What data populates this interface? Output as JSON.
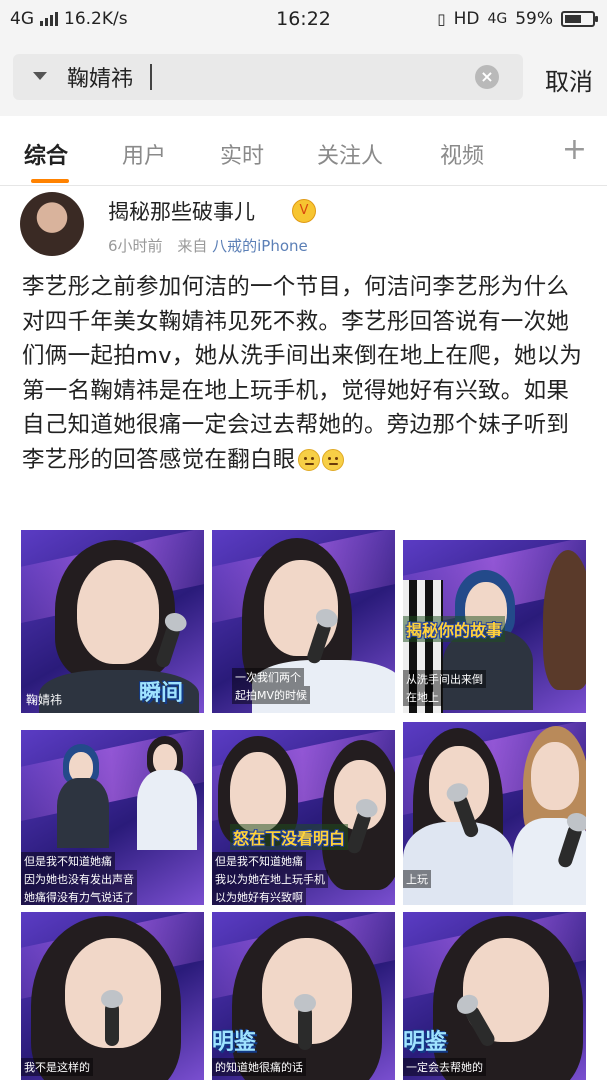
{
  "status_bar": {
    "network": "4G",
    "speed": "16.2K/s",
    "time": "16:22",
    "right_indicators": "HD",
    "network_right": "4G",
    "battery": "59%"
  },
  "search": {
    "query": "鞠婧祎",
    "cancel_label": "取消"
  },
  "tabs": [
    {
      "label": "综合",
      "active": true
    },
    {
      "label": "用户"
    },
    {
      "label": "实时"
    },
    {
      "label": "关注人"
    },
    {
      "label": "视频"
    }
  ],
  "tabs_plus": "+",
  "post": {
    "username": "揭秘那些破事儿",
    "time_ago": "6小时前",
    "from_label": "来自",
    "source": "八戒的iPhone",
    "text": "李艺彤之前参加何洁的一个节目，何洁问李艺彤为什么对四千年美女鞠婧祎见死不救。李艺彤回答说有一次她们俩一起拍mv，她从洗手间出来倒在地上在爬，她以为第一名鞠婧祎是在地上玩手机，觉得她好有兴致。如果自己知道她很痛一定会过去帮她的。旁边那个妹子听到李艺彤的回答感觉在翻白眼"
  },
  "images": {
    "img1": {
      "caption": "鞠婧祎",
      "banner": "瞬间"
    },
    "img2": {
      "caption1": "一次我们两个",
      "caption2": "起拍MV的时候"
    },
    "img3": {
      "banner": "揭秘你的故事",
      "caption1": "从洗手间出来倒",
      "caption2": "在地上"
    },
    "img4": {
      "caption1": "但是我不知道她痛",
      "caption2": "因为她也没有发出声音",
      "caption3": "她痛得没有力气说话了"
    },
    "img5": {
      "banner": "怒在下没看明白",
      "caption1": "但是我不知道她痛",
      "caption2": "我以为她在地上玩手机",
      "caption3": "以为她好有兴致啊"
    },
    "img6": {
      "caption": "上玩"
    },
    "img7": {
      "caption": "我不是这样的"
    },
    "img8": {
      "banner": "明鉴",
      "caption": "的知道她很痛的话"
    },
    "img9": {
      "banner": "明鉴",
      "caption": "一定会去帮她的"
    }
  },
  "colors": {
    "accent": "#ff8200",
    "link": "#5b7fb6"
  }
}
